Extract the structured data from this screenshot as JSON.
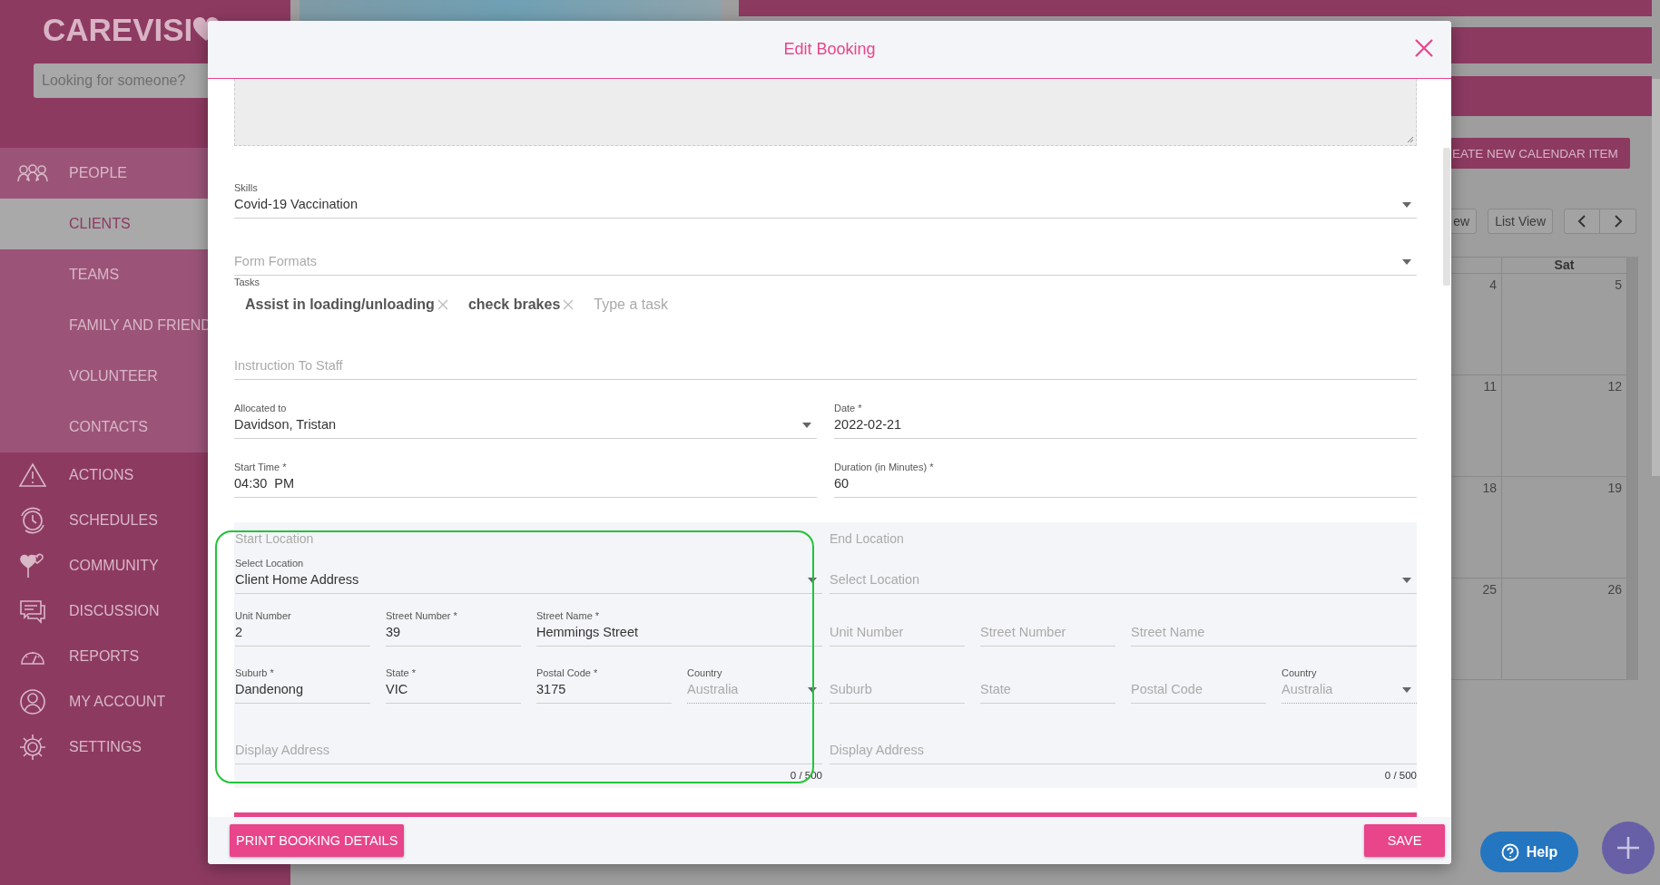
{
  "sidebar": {
    "logo": "CAREVISI",
    "search": {
      "placeholder": "Looking for someone?"
    },
    "items": [
      {
        "label": "PEOPLE",
        "selected": false,
        "children": [
          {
            "label": "CLIENTS",
            "selected": true
          },
          {
            "label": "TEAMS",
            "selected": false
          },
          {
            "label": "FAMILY AND FRIEND",
            "selected": false
          },
          {
            "label": "VOLUNTEER",
            "selected": false
          },
          {
            "label": "CONTACTS",
            "selected": false
          }
        ]
      },
      {
        "label": "ACTIONS",
        "selected": false
      },
      {
        "label": "SCHEDULES",
        "selected": false
      },
      {
        "label": "COMMUNITY",
        "selected": false
      },
      {
        "label": "DISCUSSION",
        "selected": false
      },
      {
        "label": "REPORTS",
        "selected": false
      },
      {
        "label": "MY ACCOUNT",
        "selected": false
      },
      {
        "label": "SETTINGS",
        "selected": false
      }
    ]
  },
  "calendar": {
    "create_button": "EATE NEW CALENDAR ITEM",
    "view_buttons": [
      "ew",
      "List View"
    ],
    "header_labels": [
      "Sat"
    ],
    "weeks": [
      [
        "4",
        "5"
      ],
      [
        "11",
        "12"
      ],
      [
        "18",
        "19"
      ],
      [
        "25",
        "26"
      ]
    ]
  },
  "modal": {
    "title": "Edit Booking",
    "rows": [
      [
        {
          "kind": "textarea"
        }
      ],
      [
        {
          "kind": "select",
          "label": "Skills",
          "value": "Covid-19 Vaccination"
        }
      ],
      [
        {
          "kind": "select",
          "placeholder": "Form Formats"
        }
      ],
      [
        {
          "kind": "tags",
          "label": "Tasks",
          "tags": [
            "Assist in loading/unloading",
            "check brakes"
          ],
          "placeholder": "Type a task"
        }
      ],
      [
        {
          "kind": "text",
          "placeholder": "Instruction To Staff"
        }
      ],
      [
        {
          "kind": "select",
          "label": "Allocated to",
          "value": "Davidson, Tristan"
        },
        {
          "kind": "text",
          "label": "Date *",
          "value": "2022-02-21"
        }
      ],
      [
        {
          "kind": "text",
          "label": "Start Time *",
          "value": "04:30  PM"
        },
        {
          "kind": "text",
          "label": "Duration (in Minutes) *",
          "value": "60"
        }
      ]
    ],
    "locations": [
      {
        "title": "Start Location",
        "highlighted": true,
        "select": {
          "label": "Select Location",
          "value": "Client Home Address"
        },
        "fields": [
          {
            "label": "Unit Number",
            "value": "2"
          },
          {
            "label": "Street Number *",
            "value": "39"
          },
          {
            "label": "Street Name *",
            "value": "Hemmings Street"
          },
          {
            "label": "Suburb *",
            "value": "Dandenong"
          },
          {
            "label": "State *",
            "value": "VIC"
          },
          {
            "label": "Postal Code *",
            "value": "3175"
          }
        ],
        "country": {
          "label": "Country",
          "value": "Australia",
          "disabled": true
        },
        "display_address": {
          "placeholder": "Display Address",
          "counter": "0 / 500"
        }
      },
      {
        "title": "End Location",
        "highlighted": false,
        "select": {
          "placeholder": "Select Location"
        },
        "fields": [
          {
            "placeholder": "Unit Number"
          },
          {
            "placeholder": "Street Number"
          },
          {
            "placeholder": "Street Name"
          },
          {
            "placeholder": "Suburb"
          },
          {
            "placeholder": "State"
          },
          {
            "placeholder": "Postal Code"
          }
        ],
        "country": {
          "label": "Country",
          "value": "Australia",
          "disabled": true
        },
        "display_address": {
          "placeholder": "Display Address",
          "counter": "0 / 500"
        }
      }
    ],
    "buttons": [
      {
        "label": "PRINT BOOKING DETAILS"
      },
      {
        "label": "SAVE"
      }
    ]
  },
  "help_button": {
    "label": "Help"
  }
}
